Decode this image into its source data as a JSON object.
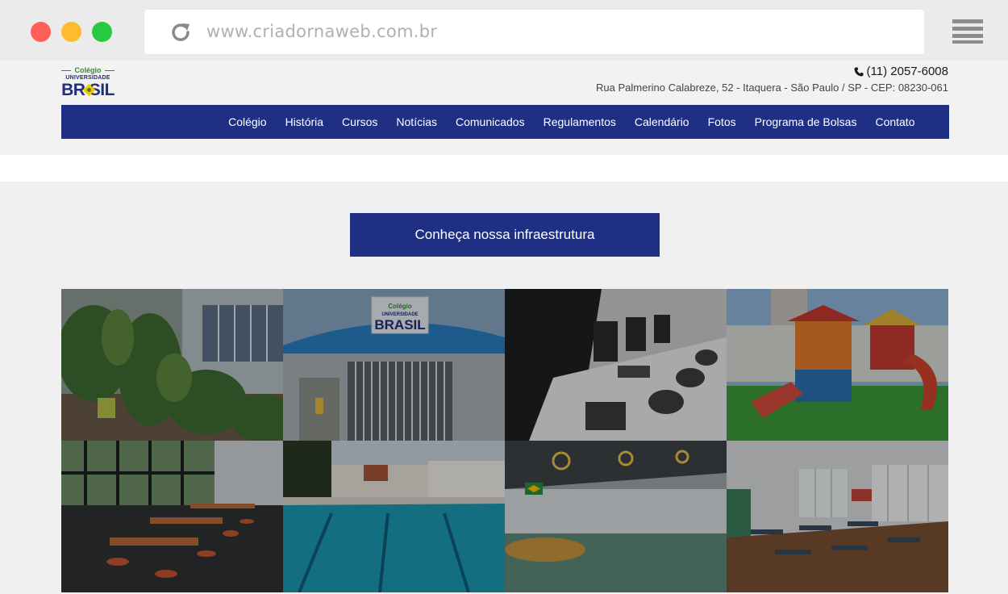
{
  "browser": {
    "url": "www.criadornaweb.com.br"
  },
  "logo": {
    "line1": "Colégio",
    "line2": "UNIVERSIDADE",
    "line3": "BR SIL"
  },
  "contact": {
    "phone": "(11) 2057-6008",
    "address": "Rua Palmerino Calabreze, 52 - Itaquera - São Paulo / SP - CEP: 08230-061"
  },
  "nav": {
    "items": [
      {
        "label": "Colégio"
      },
      {
        "label": "História"
      },
      {
        "label": "Cursos"
      },
      {
        "label": "Notícias"
      },
      {
        "label": "Comunicados"
      },
      {
        "label": "Regulamentos"
      },
      {
        "label": "Calendário"
      },
      {
        "label": "Fotos"
      },
      {
        "label": "Programa de Bolsas"
      },
      {
        "label": "Contato"
      }
    ]
  },
  "cta": {
    "label": "Conheça nossa infraestrutura"
  },
  "gallery": {
    "sign_line1": "Colégio",
    "sign_line2": "UNIVERSIDADE",
    "sign_line3": "BRASIL"
  },
  "colors": {
    "brand_blue": "#1f2f84",
    "brand_green": "#2e8b3a",
    "brand_yellow": "#f7c600"
  }
}
